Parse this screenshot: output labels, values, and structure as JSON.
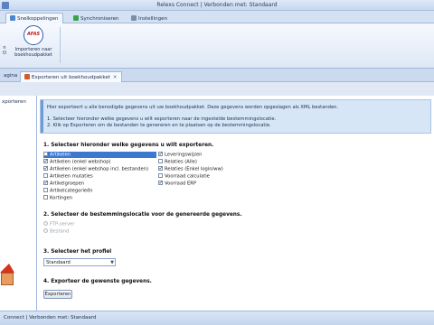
{
  "window": {
    "title": "Relexs Connect | Verbonden met: Standaard"
  },
  "ribbon_tabs": [
    {
      "label": "Snelkoppelingen",
      "active": true
    },
    {
      "label": "Synchroniseren",
      "active": false
    },
    {
      "label": "Instellingen",
      "active": false
    }
  ],
  "ribbon": {
    "left_label": "n",
    "left_sub": "O",
    "afas_logo": "AFAS",
    "import_label_1": "Importeren naar",
    "import_label_2": "boekhoudpakket"
  },
  "doc_tabs": [
    {
      "label": "agina",
      "active": false
    },
    {
      "label": "Exporteren uit boekhoudpakket",
      "active": true
    }
  ],
  "sidebar": {
    "item": "xporteren"
  },
  "info": {
    "line1": "Hier exporteert u alle benodigde gegevens uit uw boekhoudpakket. Deze gegevens worden opgeslagen als XML bestanden.",
    "line2": "1. Selecteer hieronder welke gegevens u wilt exporteren naar de ingestelde bestemmingslocatie.",
    "line3": "2. Klik op Exporteren om de bestanden te genereren en te plaatsen op de bestemmingslocatie."
  },
  "step1": {
    "title": "1. Selecteer hieronder welke gegevens u wilt exporteren.",
    "left": [
      {
        "label": "Artikelen",
        "checked": false,
        "highlight": true
      },
      {
        "label": "Artikelen (enkel webshop)",
        "checked": true
      },
      {
        "label": "Artikelen (enkel webshop incl. bestanden)",
        "checked": true
      },
      {
        "label": "Artikelen mutaties",
        "checked": false
      },
      {
        "label": "Artikelgroepen",
        "checked": true
      },
      {
        "label": "Artikelcategorieën",
        "checked": false
      },
      {
        "label": "Kortingen",
        "checked": false
      }
    ],
    "right": [
      {
        "label": "Leveringswijzen",
        "checked": true
      },
      {
        "label": "Relaties (Alle)",
        "checked": false
      },
      {
        "label": "Relaties (Enkel login/ww)",
        "checked": true
      },
      {
        "label": "Voorraad calculatie",
        "checked": false
      },
      {
        "label": "Voorraad ERP",
        "checked": true
      }
    ]
  },
  "step2": {
    "title": "2. Selecteer de bestemmingslocatie voor de genereerde gegevens.",
    "options": [
      "FTP-server",
      "Bestand"
    ]
  },
  "step3": {
    "title": "3. Selecteer het profiel",
    "profile": "Standaard"
  },
  "step4": {
    "title": "4. Exporteer de gewenste gegevens.",
    "button": "Exporteren"
  },
  "status": {
    "text": "Connect | Verbonden met: Standaard"
  },
  "colors": {
    "accent": "#3c78d0",
    "ribbon_bg": "#dde8f6",
    "info_bg": "#d7e6f7"
  }
}
